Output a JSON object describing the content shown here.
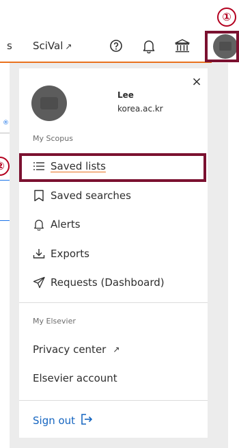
{
  "topbar": {
    "nav_partial": "s",
    "scival_label": "SciVal",
    "scival_ext": "↗",
    "help_icon": "question-circle-icon",
    "bell_icon": "bell-icon",
    "institution_icon": "institution-icon"
  },
  "annotations": {
    "badge_1": "①",
    "badge_2": "②"
  },
  "left_fragments": {
    "symbol": "®"
  },
  "menu": {
    "close": "×",
    "user": {
      "name": "Lee",
      "org": "korea.ac.kr"
    },
    "sections": {
      "my_scopus": "My Scopus",
      "my_elsevier": "My Elsevier"
    },
    "items": [
      {
        "label": "Saved lists",
        "icon": "list-icon"
      },
      {
        "label": "Saved searches",
        "icon": "bookmark-icon"
      },
      {
        "label": "Alerts",
        "icon": "bell-icon"
      },
      {
        "label": "Exports",
        "icon": "download-icon"
      },
      {
        "label": "Requests (Dashboard)",
        "icon": "send-icon"
      }
    ],
    "elsevier_items": [
      {
        "label": "Privacy center",
        "ext": "↗"
      },
      {
        "label": "Elsevier account"
      }
    ],
    "sign_out": "Sign out"
  },
  "colors": {
    "accent_orange": "#e9711c",
    "highlight_box": "#7b1130",
    "badge_red": "#b3001f",
    "link_blue": "#1565c0"
  }
}
